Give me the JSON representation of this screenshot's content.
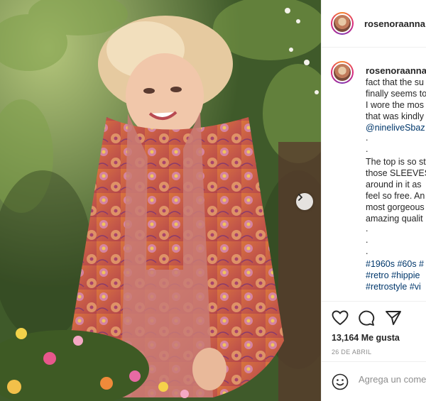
{
  "post": {
    "username": "rosenoraanna",
    "caption_lines": [
      {
        "text": "fact that the su",
        "kind": "text"
      },
      {
        "text": "finally seems to",
        "kind": "text"
      },
      {
        "text": "I wore the mos",
        "kind": "text"
      },
      {
        "text": "that was kindly",
        "kind": "text"
      },
      {
        "text": "@nineliveSbaz",
        "kind": "link"
      },
      {
        "text": ".",
        "kind": "dot"
      },
      {
        "text": ".",
        "kind": "dot"
      },
      {
        "text": "The top is so st",
        "kind": "text"
      },
      {
        "text": "those SLEEVES!",
        "kind": "text"
      },
      {
        "text": "around in it as",
        "kind": "text"
      },
      {
        "text": "feel so free. An",
        "kind": "text"
      },
      {
        "text": "most gorgeous",
        "kind": "text"
      },
      {
        "text": "amazing qualit",
        "kind": "text"
      },
      {
        "text": ".",
        "kind": "dot"
      },
      {
        "text": ".",
        "kind": "dot"
      },
      {
        "text": ".",
        "kind": "dot"
      },
      {
        "text": "#1960s #60s #",
        "kind": "link"
      },
      {
        "text": "#retro #hippie",
        "kind": "link"
      },
      {
        "text": "#retrostyle #vi",
        "kind": "link"
      }
    ],
    "likes": "13,164 Me gusta",
    "date": "26 DE ABRIL",
    "comment_placeholder": "Agrega un comentario..."
  },
  "icons": {
    "like": "heart-icon",
    "comment": "comment-bubble-icon",
    "share": "paper-plane-icon",
    "emoji": "smiley-icon",
    "next": "chevron-right-icon"
  },
  "colors": {
    "link": "#00376b",
    "text": "#262626",
    "muted": "#8e8e8e",
    "border": "#efefef"
  }
}
